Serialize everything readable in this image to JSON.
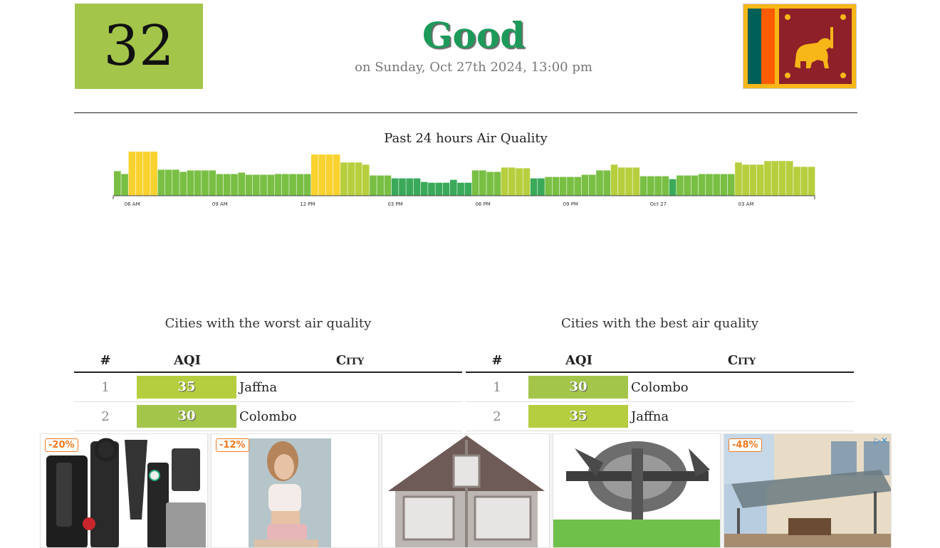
{
  "current": {
    "aqi": "32",
    "status": "Good",
    "datetime": "on Sunday, Oct 27th 2024, 13:00 pm",
    "status_color": "#1d9a5a",
    "aqi_color": "#a3c54a"
  },
  "flag": {
    "icon": "sri-lanka-flag"
  },
  "chart_data": {
    "type": "bar",
    "title": "Past 24 hours Air Quality",
    "x_tick_labels": [
      "06 AM",
      "09 AM",
      "12 PM",
      "03 PM",
      "06 PM",
      "09 PM",
      "Oct 27",
      "03 AM"
    ],
    "values": [
      34,
      30,
      61,
      61,
      61,
      61,
      36,
      36,
      36,
      33,
      35,
      35,
      35,
      35,
      30,
      30,
      30,
      32,
      29,
      29,
      29,
      29,
      30,
      30,
      30,
      30,
      30,
      57,
      57,
      57,
      57,
      46,
      46,
      46,
      43,
      28,
      28,
      28,
      24,
      24,
      24,
      24,
      19,
      18,
      18,
      18,
      22,
      18,
      18,
      35,
      35,
      33,
      33,
      39,
      39,
      38,
      38,
      24,
      24,
      26,
      26,
      26,
      26,
      26,
      29,
      29,
      35,
      35,
      43,
      39,
      39,
      39,
      27,
      27,
      27,
      27,
      23,
      28,
      28,
      28,
      30,
      30,
      30,
      30,
      30,
      46,
      43,
      43,
      43,
      48,
      48,
      48,
      48,
      40,
      40,
      40
    ],
    "colors_by_level": {
      "low": "#3aaa5a",
      "moderate": "#79bf44",
      "elevated": "#b7cf3e",
      "high": "#f9d230"
    }
  },
  "worst": {
    "title": "Cities with the worst air quality",
    "headers": {
      "rank": "#",
      "aqi": "AQI",
      "city": "City"
    },
    "rows": [
      {
        "rank": "1",
        "aqi": "35",
        "city": "Jaffna",
        "color": "#b5ce3f"
      },
      {
        "rank": "2",
        "aqi": "30",
        "city": "Colombo",
        "color": "#a3c54a"
      }
    ]
  },
  "best": {
    "title": "Cities with the best air quality",
    "headers": {
      "rank": "#",
      "aqi": "AQI",
      "city": "City"
    },
    "rows": [
      {
        "rank": "1",
        "aqi": "30",
        "city": "Colombo",
        "color": "#a3c54a"
      },
      {
        "rank": "2",
        "aqi": "35",
        "city": "Jaffna",
        "color": "#b5ce3f"
      }
    ]
  },
  "ads": [
    {
      "badge": "-20%",
      "image": "survival-knife-kit"
    },
    {
      "badge": "-12%",
      "image": "woman-photo"
    },
    {
      "badge": "",
      "image": "wooden-pet-cage"
    },
    {
      "badge": "",
      "image": "tiller-blades"
    },
    {
      "badge": "-48%",
      "image": "glass-patio-awning"
    }
  ]
}
